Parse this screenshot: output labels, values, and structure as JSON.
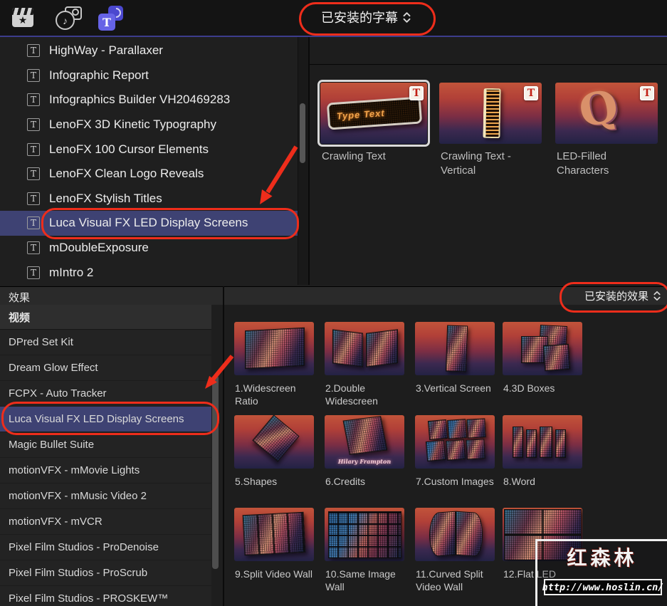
{
  "toolbar": {
    "icons": [
      "effects-browser",
      "photos-audio-browser",
      "titles-generators-browser"
    ],
    "titles_filter": {
      "label": "已安装的字幕"
    }
  },
  "titles_panel": {
    "items": [
      "HighWay - Parallaxer",
      "Infographic Report",
      "Infographics Builder VH20469283",
      "LenoFX 3D Kinetic Typography",
      "LenoFX 100 Cursor Elements",
      "LenoFX Clean Logo Reveals",
      "LenoFX Stylish Titles",
      "Luca Visual FX LED Display Screens",
      "mDoubleExposure",
      "mIntro 2"
    ],
    "selected_item": "Luca Visual FX LED Display Screens",
    "thumbnails": [
      {
        "label": "Crawling Text",
        "badge": "T",
        "led_text": "Type Text",
        "selected": true
      },
      {
        "label": "Crawling Text - Vertical",
        "badge": "T"
      },
      {
        "label": "LED-Filled Characters",
        "badge": "T",
        "glyph": "Q"
      }
    ]
  },
  "effects_panel": {
    "header": "效果",
    "filter": {
      "label": "已安装的效果"
    },
    "category_header": "视频",
    "items": [
      "DPred Set Kit",
      "Dream Glow Effect",
      "FCPX - Auto Tracker",
      "Luca Visual FX LED Display Screens",
      "Magic Bullet Suite",
      "motionVFX - mMovie Lights",
      "motionVFX - mMusic Video 2",
      "motionVFX - mVCR",
      "Pixel Film Studios - ProDenoise",
      "Pixel Film Studios - ProScrub",
      "Pixel Film Studios - PROSKEW™"
    ],
    "selected_item": "Luca Visual FX LED Display Screens",
    "grid": [
      {
        "label": "1.Widescreen Ratio"
      },
      {
        "label": "2.Double Widescreen"
      },
      {
        "label": "3.Vertical Screen"
      },
      {
        "label": "4.3D Boxes"
      },
      {
        "label": "5.Shapes"
      },
      {
        "label": "6.Credits",
        "caption": "Hilary Frampton"
      },
      {
        "label": "7.Custom Images"
      },
      {
        "label": "8.Word"
      },
      {
        "label": "9.Split Video Wall"
      },
      {
        "label": "10.Same Image Wall"
      },
      {
        "label": "11.Curved Split Video Wall"
      },
      {
        "label": "12.Flat LED"
      }
    ]
  },
  "watermark": {
    "brand": "红森林",
    "url": "http://www.hoslin.cn/"
  },
  "colors": {
    "selection_blue": "#3e4273",
    "annotation_red": "#ee2d1b",
    "titles_icon_blue": "#6663e6",
    "thumb_gradient_top": "#c2543a",
    "thumb_gradient_bottom": "#232244"
  }
}
